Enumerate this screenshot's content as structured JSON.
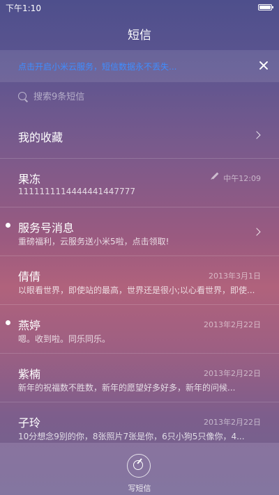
{
  "status_bar": {
    "time": "下午1:10"
  },
  "header": {
    "title": "短信"
  },
  "banner": {
    "text": "点击开启小米云服务，短信数据永不丢失..."
  },
  "search": {
    "placeholder": "搜索9条短信"
  },
  "favorites": {
    "label": "我的收藏"
  },
  "threads": [
    {
      "name": "果冻",
      "preview": "1111111114444441447777",
      "date": "中午12:09",
      "unread": false,
      "draft": true,
      "chevron": false
    },
    {
      "name": "服务号消息",
      "preview": "重磅福利，云服务送小米5啦，点击领取!",
      "date": "",
      "unread": true,
      "draft": false,
      "chevron": true
    },
    {
      "name": "倩倩",
      "preview": "以眼看世界，即使站的最高，世界还是很小;以心看世界，即使...",
      "date": "2013年3月1日",
      "unread": false,
      "draft": false,
      "chevron": false
    },
    {
      "name": "燕婷",
      "preview": "嗯。收到啦。同乐同乐。",
      "date": "2013年2月22日",
      "unread": true,
      "draft": false,
      "chevron": false
    },
    {
      "name": "紫楠",
      "preview": "新年的祝福数不胜数，新年的愿望好多好多，新年的问候...",
      "date": "2013年2月22日",
      "unread": false,
      "draft": false,
      "chevron": false
    },
    {
      "name": "子玲",
      "preview": "10分想念9别的你，8张照片7张是你，6只小狗5只像你，4...",
      "date": "2013年2月22日",
      "unread": false,
      "draft": false,
      "chevron": false
    }
  ],
  "bottom": {
    "compose_label": "写短信"
  },
  "icons": {
    "battery": "battery-icon",
    "close": "close-icon",
    "search": "search-icon",
    "chevron": "chevron-right-icon",
    "draft": "pencil-icon",
    "compose": "compose-icon"
  },
  "colors": {
    "banner_link": "#3f8dff"
  }
}
